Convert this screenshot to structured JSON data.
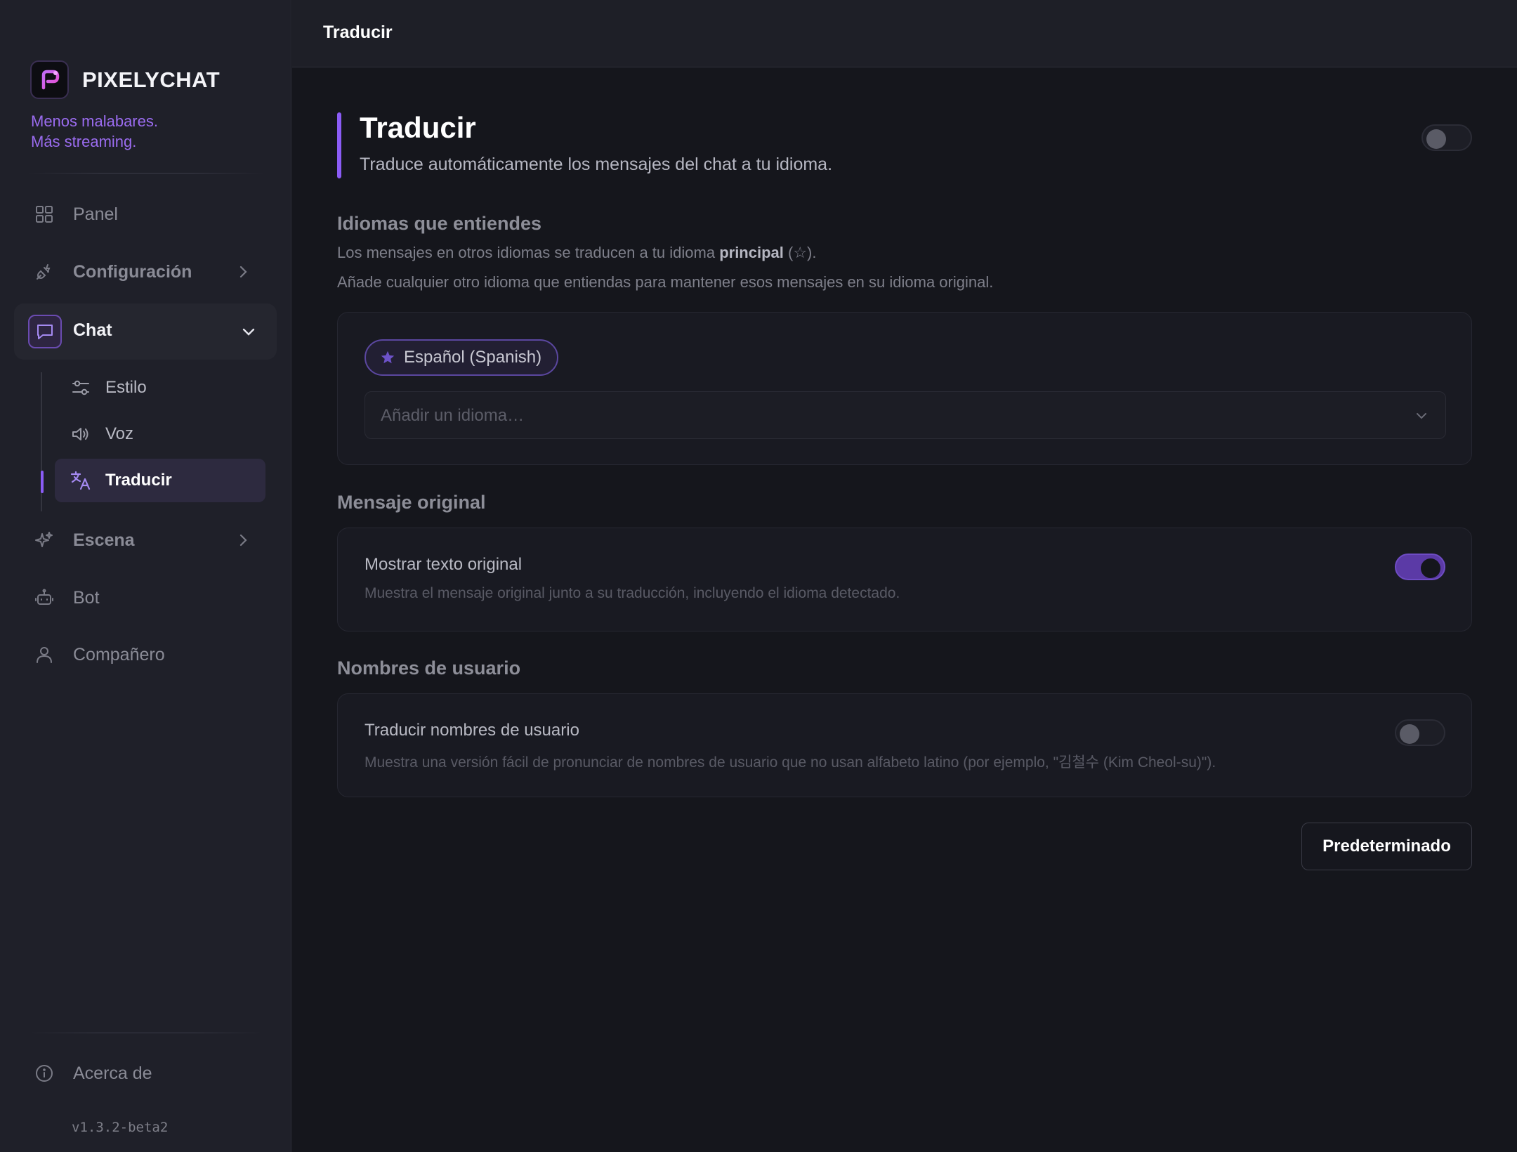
{
  "brand": {
    "name": "PIXELYCHAT",
    "tagline_line1": "Menos malabares.",
    "tagline_line2": "Más streaming.",
    "accent": "#8b5cf6"
  },
  "sidebar": {
    "items": [
      {
        "label": "Panel",
        "icon": "grid-icon"
      },
      {
        "label": "Configuración",
        "icon": "plug-icon"
      },
      {
        "label": "Chat",
        "icon": "chat-bubble-icon",
        "expanded": true
      },
      {
        "label": "Escena",
        "icon": "sparkle-icon"
      },
      {
        "label": "Bot",
        "icon": "robot-icon"
      },
      {
        "label": "Compañero",
        "icon": "user-icon"
      }
    ],
    "chat_sub": [
      {
        "label": "Estilo",
        "icon": "sliders-icon"
      },
      {
        "label": "Voz",
        "icon": "speaker-icon"
      },
      {
        "label": "Traducir",
        "icon": "translate-icon",
        "active": true
      }
    ],
    "about": "Acerca de",
    "version": "v1.3.2-beta2"
  },
  "topbar": {
    "title": "Traducir"
  },
  "page": {
    "title": "Traducir",
    "subtitle": "Traduce automáticamente los mensajes del chat a tu idioma.",
    "enabled": false
  },
  "languages": {
    "title": "Idiomas que entiendes",
    "desc1_pre": "Los mensajes en otros idiomas se traducen a tu idioma ",
    "desc1_bold": "principal",
    "desc1_post": " (☆).",
    "desc2": "Añade cualquier otro idioma que entiendas para mantener esos mensajes en su idioma original.",
    "chips": [
      {
        "label": "Español (Spanish)",
        "primary": true
      }
    ],
    "add_placeholder": "Añadir un idioma…"
  },
  "original": {
    "title": "Mensaje original",
    "row_title": "Mostrar texto original",
    "row_desc": "Muestra el mensaje original junto a su traducción, incluyendo el idioma detectado.",
    "enabled": true
  },
  "usernames": {
    "title": "Nombres de usuario",
    "row_title": "Traducir nombres de usuario",
    "row_desc": "Muestra una versión fácil de pronunciar de nombres de usuario que no usan alfabeto latino (por ejemplo, \"김철수 (Kim Cheol-su)\").",
    "enabled": false
  },
  "actions": {
    "default_label": "Predeterminado"
  }
}
